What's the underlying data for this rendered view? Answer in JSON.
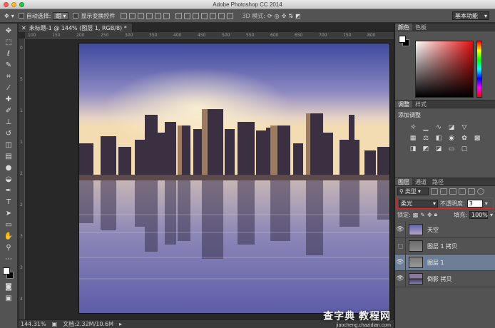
{
  "window": {
    "title": "Adobe Photoshop CC 2014",
    "traffic_lights": [
      "#ff5f57",
      "#febc2e",
      "#28c840"
    ]
  },
  "options_bar": {
    "auto_select_label": "自动选择:",
    "auto_select_value": "组",
    "show_transform_label": "显示变换控件",
    "mode_3d_label": "3D 模式:",
    "workspace": "基本功能"
  },
  "document": {
    "tab_title": "未标题-1 @ 144% (图层 1, RGB/8) *",
    "close_icon": "close-icon",
    "zoom": "144.31%",
    "doc_size": "文档:2.32M/10.6M",
    "ruler_top_ticks": [
      "100",
      "150",
      "200",
      "250",
      "300",
      "350",
      "400",
      "450",
      "500",
      "550",
      "600",
      "650",
      "700",
      "750",
      "800"
    ],
    "ruler_left_ticks": [
      "0",
      "5",
      "1",
      "1",
      "2",
      "2",
      "3",
      "3",
      "4"
    ]
  },
  "color_panel": {
    "tabs": [
      "颜色",
      "色板"
    ]
  },
  "adjustments_panel": {
    "tabs": [
      "调整",
      "样式"
    ],
    "title": "添加调整"
  },
  "layers_panel": {
    "tabs": [
      "图层",
      "通道",
      "路径"
    ],
    "kind_filter": "类型",
    "blend_mode": "柔光",
    "opacity_label": "不透明度:",
    "opacity_value": "3",
    "lock_label": "锁定:",
    "fill_label": "填充:",
    "fill_value": "100%",
    "layers": [
      {
        "name": "天空",
        "visible": true,
        "selected": false
      },
      {
        "name": "图层 1 拷贝",
        "visible": false,
        "selected": false
      },
      {
        "name": "图层 1",
        "visible": true,
        "selected": true
      },
      {
        "name": "倒影 拷贝",
        "visible": true,
        "selected": false
      }
    ]
  },
  "watermark": {
    "main": "查字典 教程网",
    "sub": "jiaocheng.chazidian.com"
  },
  "colors": {
    "panel_bg": "#535353",
    "selected_layer": "#6d7f96",
    "highlight_box": "#d62a2a"
  }
}
